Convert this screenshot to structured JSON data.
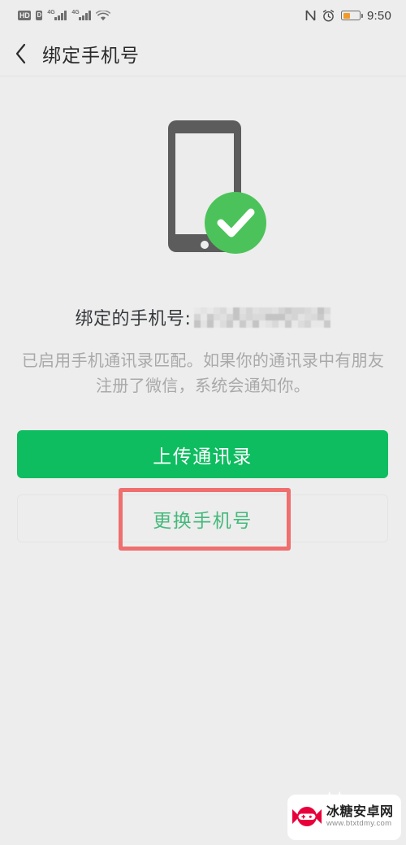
{
  "statusbar": {
    "hd_label": "HD",
    "sim_label": "D",
    "network_generation_1": "4G",
    "network_generation_2": "4G",
    "wifi_icon": "wifi-icon",
    "nfc_icon": "nfc-icon",
    "alarm_icon": "alarm-icon",
    "battery_icon": "battery-icon",
    "battery_fill_percent": 45,
    "battery_color": "#f29a28",
    "time": "9:50"
  },
  "header": {
    "back_icon": "chevron-left-icon",
    "title": "绑定手机号"
  },
  "illustration": {
    "phone_icon": "phone-illustration",
    "phone_color": "#5c5c5c",
    "check_badge_icon": "check-circle-icon",
    "check_badge_color": "#4cc35a"
  },
  "bound": {
    "label": "绑定的手机号:",
    "number_value": "",
    "number_masked": true
  },
  "description": {
    "text": "已启用手机通讯录匹配。如果你的通讯录中有朋友注册了微信，系统会通知你。"
  },
  "actions": {
    "upload_contacts_label": "上传通讯录",
    "upload_contacts_color": "#0dbd5f",
    "change_phone_label": "更换手机号",
    "change_phone_color": "#45b97c"
  },
  "annotation": {
    "shape": "rectangle",
    "color": "#ef6e6e",
    "target": "更换手机号"
  },
  "watermark": {
    "logo_icon": "candy-gamepad-logo-icon",
    "site_name": "冰糖安卓网",
    "site_url": "www.btxtdmy.com",
    "logo_color": "#e8003c"
  }
}
